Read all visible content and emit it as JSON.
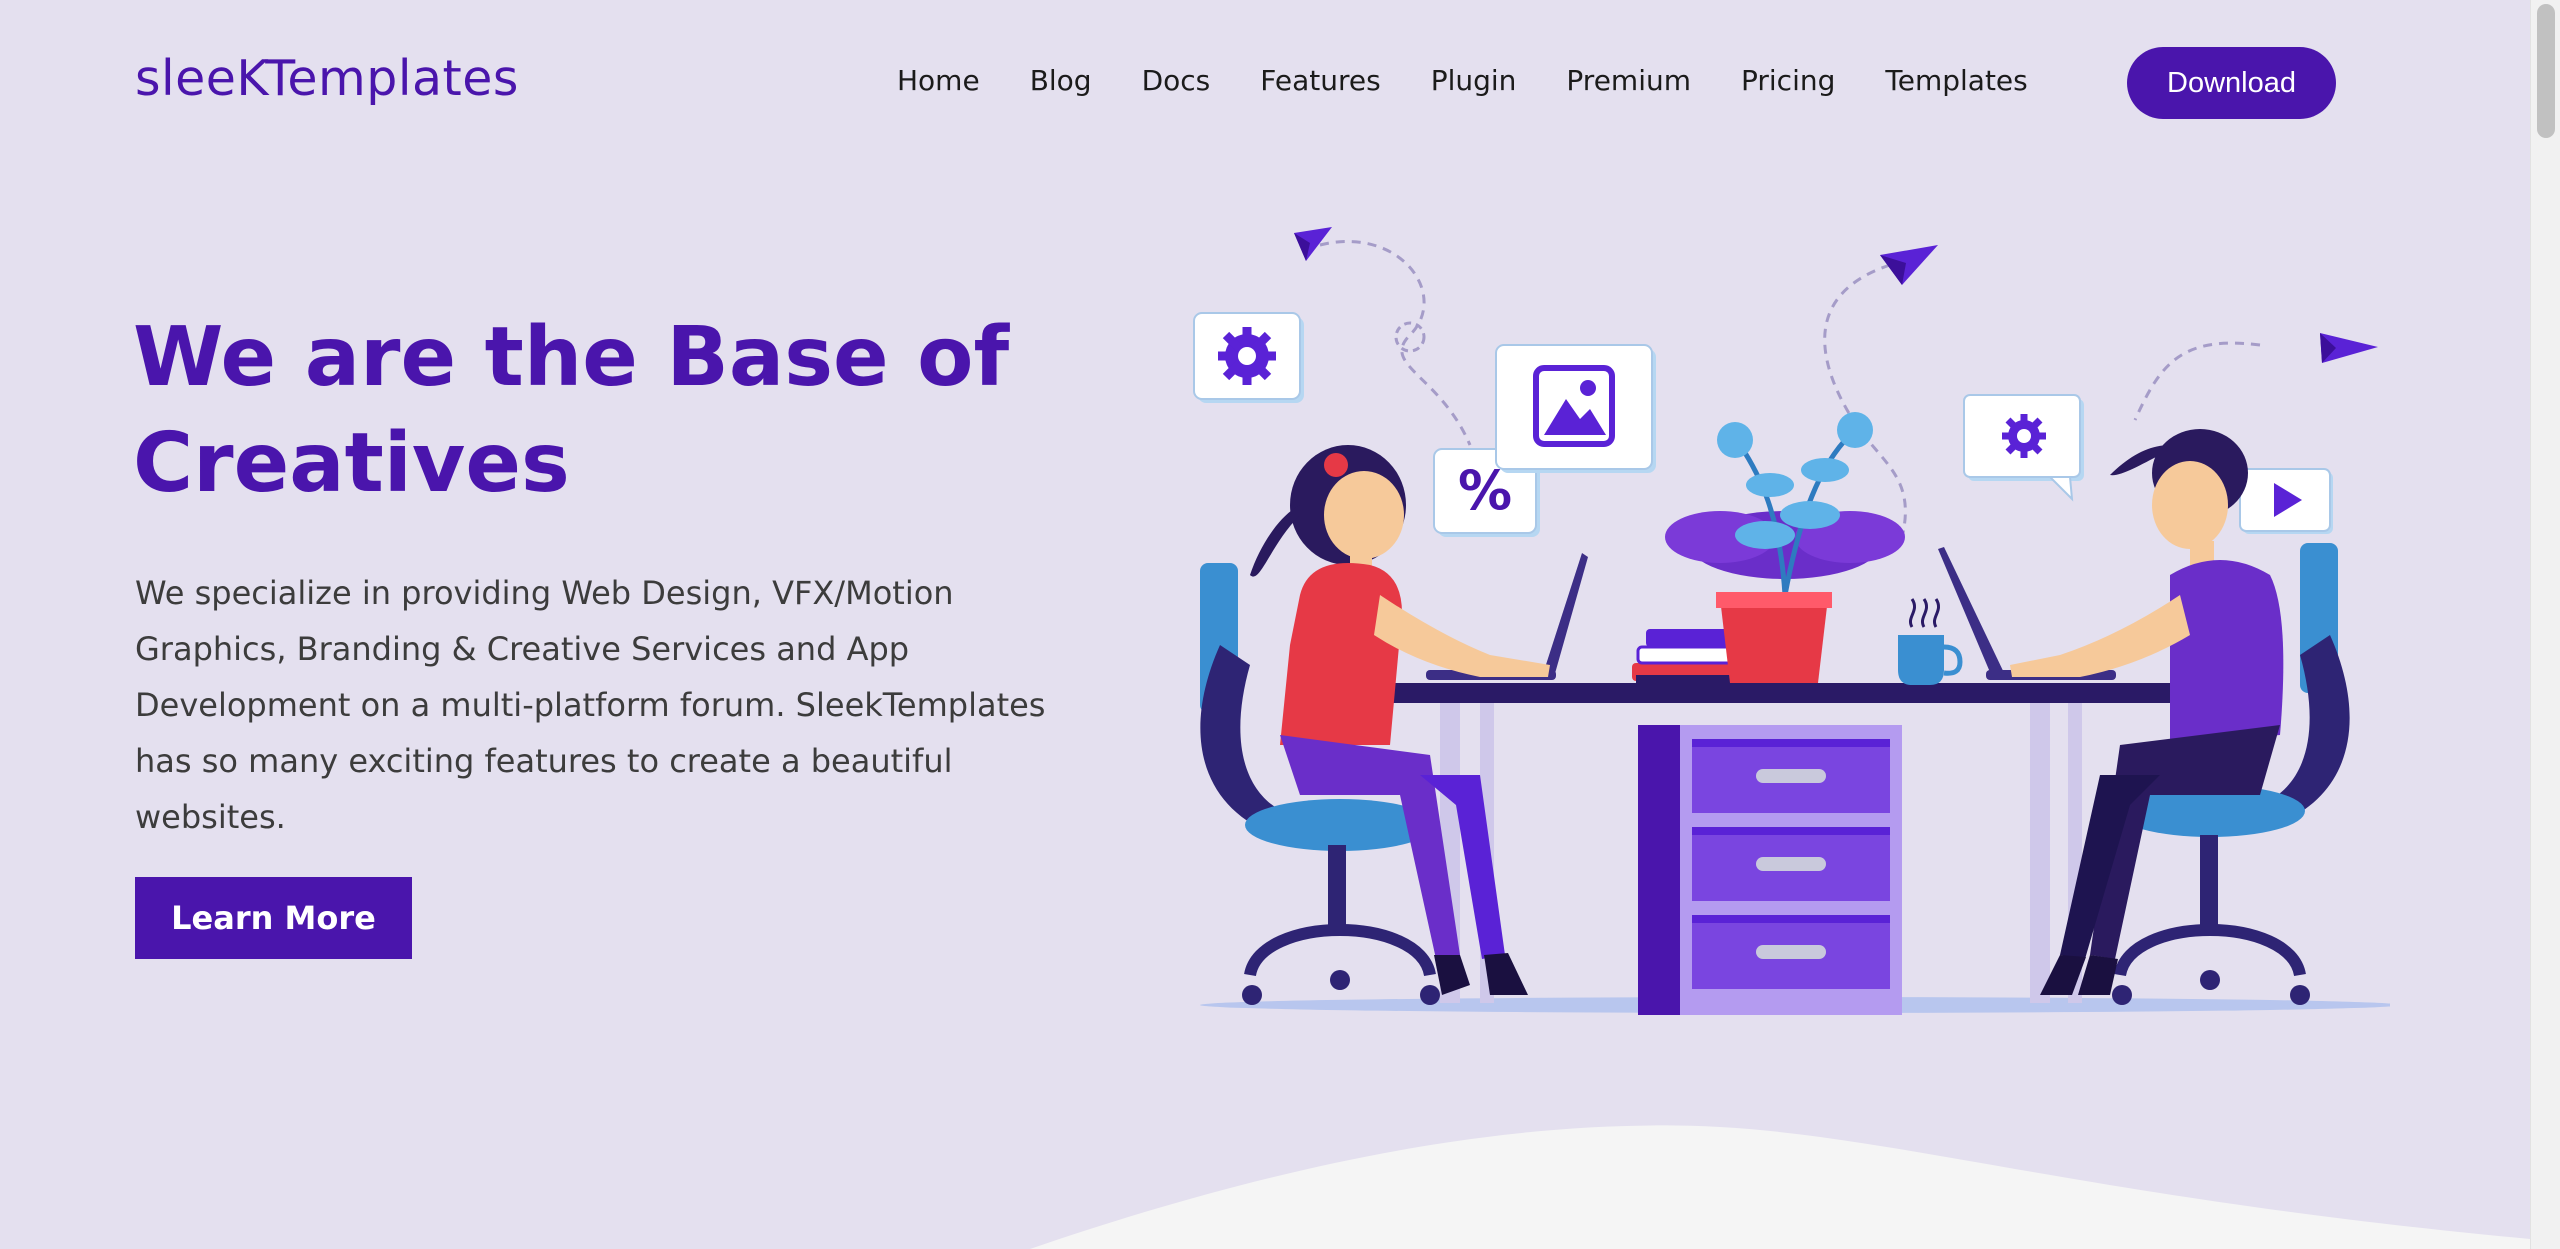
{
  "header": {
    "logo": "sleeKTemplates",
    "nav": [
      "Home",
      "Blog",
      "Docs",
      "Features",
      "Plugin",
      "Premium",
      "Pricing",
      "Templates"
    ],
    "download_label": "Download"
  },
  "hero": {
    "title_line1": "We are the Base of",
    "title_line2": "Creatives",
    "description": "We specialize in providing Web Design, VFX/Motion Graphics, Branding & Creative Services and App Development on a multi-platform forum. SleekTemplates has so many exciting features to create a beautiful websites.",
    "cta_label": "Learn More"
  },
  "illustration": {
    "badge_percent": "%"
  },
  "colors": {
    "background": "#e4e0ef",
    "brand": "#4a15ac",
    "wave": "#f5f5f5"
  }
}
